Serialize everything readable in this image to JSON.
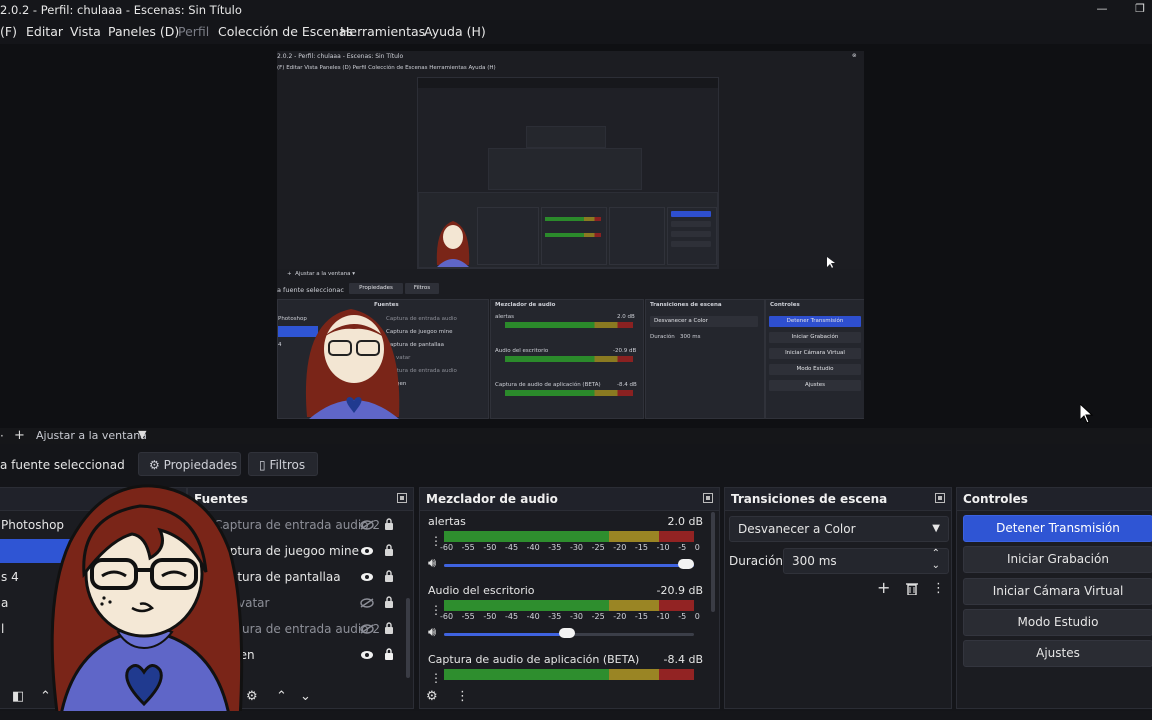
{
  "window": {
    "title": "2.0.2 - Perfil: chulaaa - Escenas: Sin Título"
  },
  "menu": {
    "items": [
      {
        "label": "(F)",
        "disabled": false
      },
      {
        "label": "Editar",
        "disabled": false
      },
      {
        "label": "Vista",
        "disabled": false
      },
      {
        "label": "Paneles (D)",
        "disabled": false
      },
      {
        "label": "Perfil",
        "disabled": true
      },
      {
        "label": "Colección de Escenas",
        "disabled": false
      },
      {
        "label": "Herramientas",
        "disabled": false
      },
      {
        "label": "Ayuda (H)",
        "disabled": false
      }
    ]
  },
  "preview": {
    "zoom_label": "Ajustar a la ventana",
    "nested": {
      "title": "2.0.2 - Perfil: chulaaa - Escenas: Sin Título",
      "menu": "(F)   Editar   Vista   Paneles (D)   Perfil   Colección de Escenas   Herramientas   Ayuda (H)",
      "zoom_label": "Ajustar a la ventana",
      "source_label": "a fuente seleccionac",
      "properties": "Propiedades",
      "filters": "Filtros",
      "sources_title": "Fuentes",
      "sources": [
        "Captura de entrada audio",
        "Captura de juegoo mine",
        "Captura de pantallaa",
        "vatar",
        "Captura de entrada audio",
        "gen"
      ],
      "scene_items": [
        "Photoshop",
        "",
        "4"
      ],
      "mixer_title": "Mezclador de audio",
      "mixer_tracks": [
        {
          "name": "alertas",
          "db": "2.0 dB"
        },
        {
          "name": "Audio del escritorio",
          "db": "-20.9 dB"
        },
        {
          "name": "Captura de audio de aplicación (BETA)",
          "db": "-8.4 dB"
        }
      ],
      "transitions_title": "Transiciones de escena",
      "transition": "Desvanecer a Color",
      "duration_label": "Duración",
      "duration": "300 ms",
      "controls_title": "Controles",
      "controls": [
        "Detener Transmisión",
        "Iniciar Grabación",
        "Iniciar Cámara Virtual",
        "Modo Estudio",
        "Ajustes"
      ]
    }
  },
  "toolbar": {
    "zoom_label": "Ajustar a la ventana"
  },
  "source_bar": {
    "selected_label": "a fuente seleccionad",
    "properties_label": "Propiedades",
    "filters_label": "Filtros"
  },
  "scenes": {
    "items": [
      {
        "label": "Photoshop",
        "selected": false
      },
      {
        "label": "",
        "selected": true
      },
      {
        "label": "s 4",
        "selected": false
      },
      {
        "label": "a",
        "selected": false
      },
      {
        "label": "l",
        "selected": false
      }
    ]
  },
  "sources": {
    "title": "Fuentes",
    "items": [
      {
        "label": "Captura de entrada audio 2",
        "visible": false,
        "locked": true
      },
      {
        "label": "Captura de juegoo mine",
        "visible": true,
        "locked": true
      },
      {
        "label": "Captura de pantallaa",
        "visible": true,
        "locked": true
      },
      {
        "label": "vatar",
        "visible": false,
        "locked": true
      },
      {
        "label": "Captura de entrada audio 2",
        "visible": false,
        "locked": true
      },
      {
        "label": "gen",
        "visible": true,
        "locked": true
      }
    ]
  },
  "mixer": {
    "title": "Mezclador de audio",
    "scale": [
      "-60",
      "-55",
      "-50",
      "-45",
      "-40",
      "-35",
      "-30",
      "-25",
      "-20",
      "-15",
      "-10",
      "-5",
      "0"
    ],
    "tracks": [
      {
        "name": "alertas",
        "db": "2.0 dB",
        "volume": 1.0
      },
      {
        "name": "Audio del escritorio",
        "db": "-20.9 dB",
        "volume": 0.49
      },
      {
        "name": "Captura de audio de aplicación (BETA)",
        "db": "-8.4 dB",
        "volume": null
      }
    ]
  },
  "transitions": {
    "title": "Transiciones de escena",
    "selected": "Desvanecer a Color",
    "duration_label": "Duración",
    "duration_value": "300 ms"
  },
  "controls": {
    "title": "Controles",
    "buttons": [
      {
        "label": "Detener Transmisión",
        "primary": true
      },
      {
        "label": "Iniciar Grabación",
        "primary": false
      },
      {
        "label": "Iniciar Cámara Virtual",
        "primary": false
      },
      {
        "label": "Modo Estudio",
        "primary": false
      },
      {
        "label": "Ajustes",
        "primary": false
      }
    ]
  },
  "colors": {
    "accent": "#2f55d4",
    "meter_green": "#2e8e2e",
    "meter_yellow": "#9a8524",
    "meter_red": "#922323",
    "avatar_hair": "#7a2518",
    "avatar_sweater": "#5f66c8",
    "avatar_heart": "#203a8f"
  }
}
